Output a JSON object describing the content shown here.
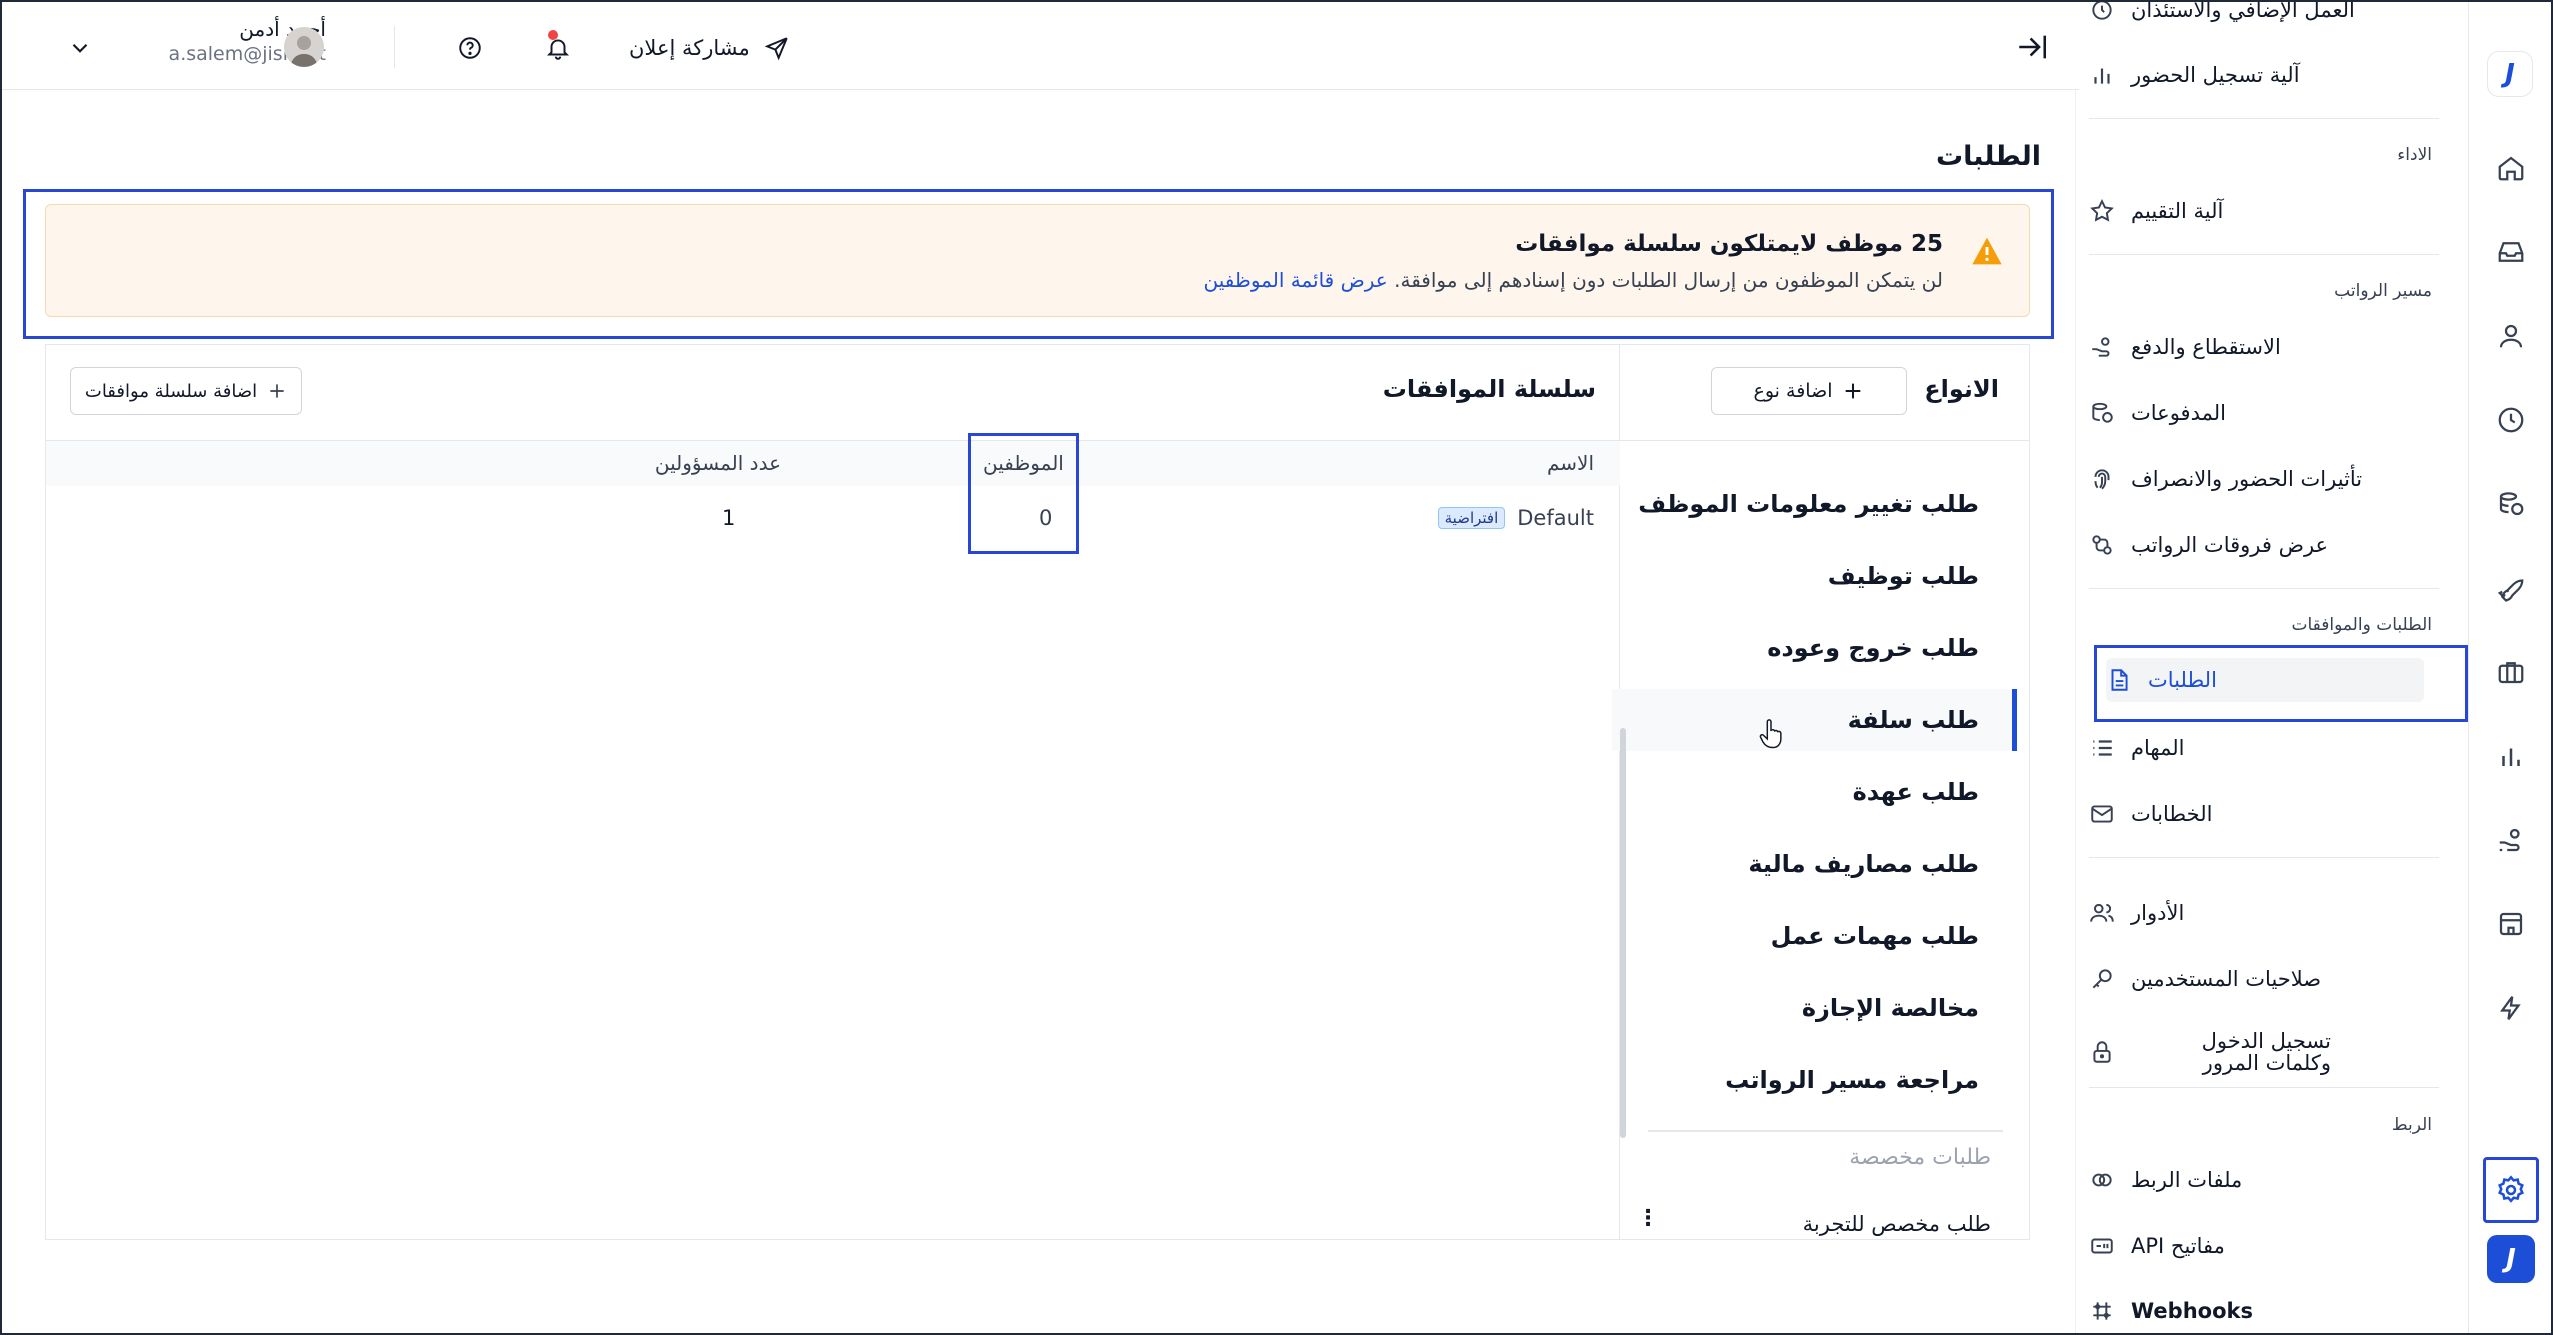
{
  "header": {
    "user_name": "أحمد أدمن",
    "user_email": "a.salem@jisr.net",
    "share_label": "مشاركة إعلان"
  },
  "page": {
    "title": "الطلبات"
  },
  "alert": {
    "title": "25 موظف لايمتلكون سلسلة موافقات",
    "text": "لن يتمكن الموظفون من إرسال الطلبات دون إسنادهم إلى موافقة.",
    "link": "عرض قائمة الموظفين"
  },
  "types_panel": {
    "title": "الانواع",
    "add_label": "اضافة نوع",
    "items": [
      "طلب تغيير معلومات الموظف",
      "طلب توظيف",
      "طلب خروج وعوده",
      "طلب سلفة",
      "طلب عهدة",
      "طلب مصاريف مالية",
      "طلب مهمات عمل",
      "مخالصة الإجازة",
      "مراجعة مسير الرواتب"
    ],
    "custom_heading": "طلبات مخصصة",
    "custom_items": [
      "طلب مخصص للتجربة"
    ]
  },
  "chain_panel": {
    "title": "سلسلة الموافقات",
    "add_label": "اضافة سلسلة موافقات",
    "columns": {
      "name": "الاسم",
      "employees": "الموظفين",
      "approvers": "عدد المسؤولين"
    },
    "rows": [
      {
        "name": "Default",
        "badge": "افتراضية",
        "employees": "0",
        "approvers": "1"
      }
    ]
  },
  "sidebar": {
    "top_partial": "العمل الإضافي والاستئذان",
    "attendance_label": "آلية تسجيل الحضور",
    "sections": {
      "performance": "الاداء",
      "payroll": "مسير الرواتب",
      "requests": "الطلبات والموافقات",
      "integration": "الربط"
    },
    "items": {
      "evaluation": "آلية التقييم",
      "deductions": "الاستقطاع والدفع",
      "payments": "المدفوعات",
      "attendance_effects": "تأثيرات الحضور والانصراف",
      "payroll_diff": "عرض فروقات الرواتب",
      "requests": "الطلبات",
      "tasks": "المهام",
      "letters": "الخطابات",
      "roles": "الأدوار",
      "permissions": "صلاحيات المستخدمين",
      "login": "تسجيل الدخول وكلمات المرور",
      "integration_files": "ملفات الربط",
      "api_keys": "مفاتيح API",
      "webhooks": "Webhooks"
    }
  },
  "colors": {
    "accent": "#1d4ed8",
    "alert_bg": "#fef6ec",
    "alert_border": "#f5d9b0",
    "warning": "#f59e0b",
    "highlight_box": "#2847d6",
    "badge_bg": "#dbeafe",
    "notification_dot": "#ef4444"
  }
}
